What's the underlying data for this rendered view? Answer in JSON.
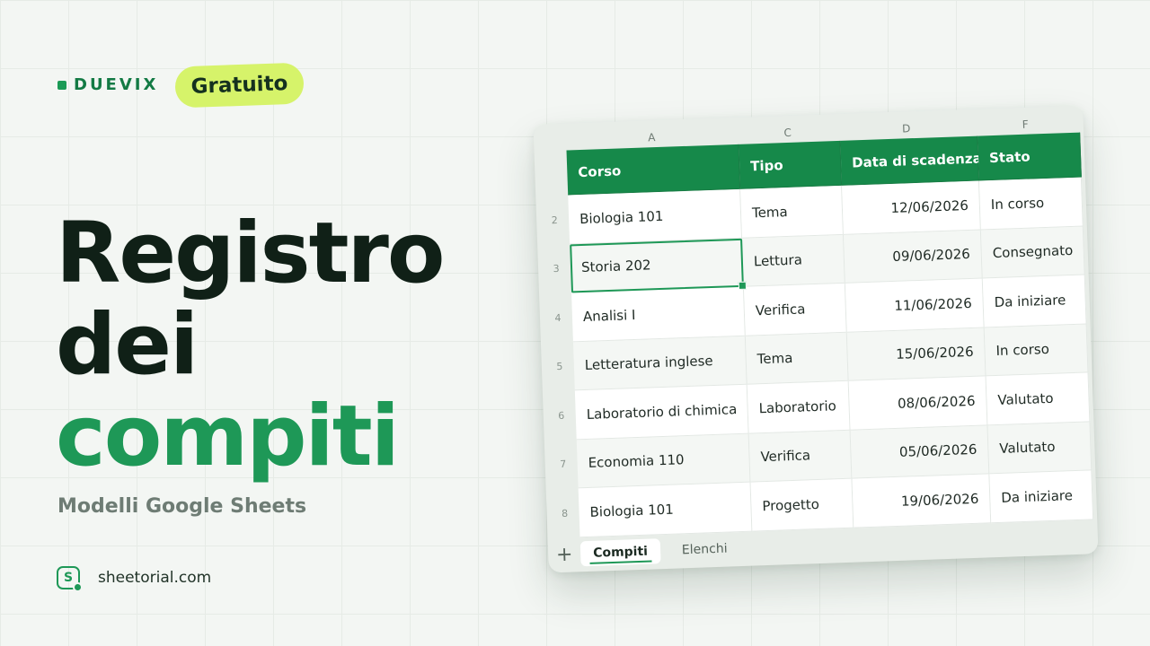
{
  "brand": {
    "name": "DUEVIX"
  },
  "badge": {
    "label": "Gratuito"
  },
  "title": {
    "line1": "Registro",
    "line2": "dei",
    "line3": "compiti"
  },
  "subtitle": "Modelli Google Sheets",
  "site": {
    "logo_letter": "S",
    "name": "sheetorial.com"
  },
  "sheet": {
    "column_letters": [
      "A",
      "C",
      "D",
      "F"
    ],
    "headers": [
      "Corso",
      "Tipo",
      "Data di scadenza",
      "Stato"
    ],
    "rows": [
      {
        "num": "2",
        "corso": "Biologia 101",
        "tipo": "Tema",
        "data": "12/06/2026",
        "stato": "In corso"
      },
      {
        "num": "3",
        "corso": "Storia 202",
        "tipo": "Lettura",
        "data": "09/06/2026",
        "stato": "Consegnato"
      },
      {
        "num": "4",
        "corso": "Analisi I",
        "tipo": "Verifica",
        "data": "11/06/2026",
        "stato": "Da iniziare"
      },
      {
        "num": "5",
        "corso": "Letteratura inglese",
        "tipo": "Tema",
        "data": "15/06/2026",
        "stato": "In corso"
      },
      {
        "num": "6",
        "corso": "Laboratorio di chimica",
        "tipo": "Laboratorio",
        "data": "08/06/2026",
        "stato": "Valutato"
      },
      {
        "num": "7",
        "corso": "Economia 110",
        "tipo": "Verifica",
        "data": "05/06/2026",
        "stato": "Valutato"
      },
      {
        "num": "8",
        "corso": "Biologia 101",
        "tipo": "Progetto",
        "data": "19/06/2026",
        "stato": "Da iniziare"
      }
    ],
    "tabs": {
      "add_icon": "+",
      "active": "Compiti",
      "other": "Elenchi"
    }
  },
  "colors": {
    "accent": "#1e9857",
    "header_green": "#16894a",
    "badge_lime": "#d6f36a",
    "title_dark": "#102017"
  }
}
